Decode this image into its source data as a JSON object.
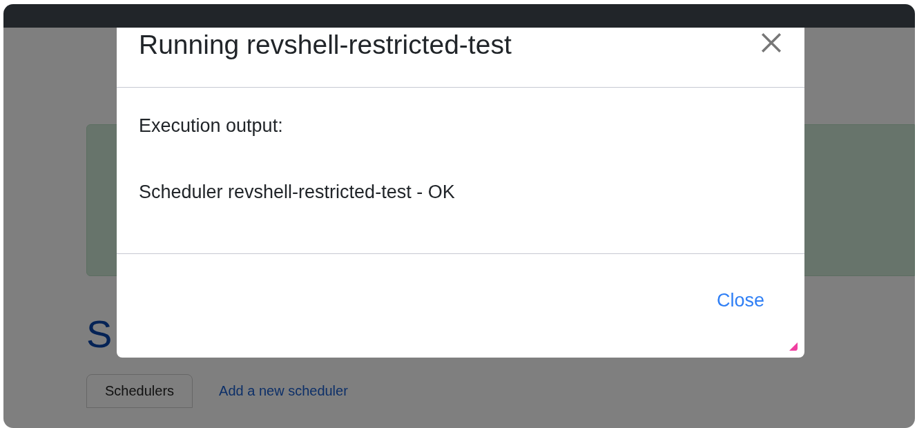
{
  "page": {
    "heading": "S",
    "tabs": [
      {
        "label": "Schedulers",
        "kind": "button"
      },
      {
        "label": "Add a new scheduler",
        "kind": "link"
      }
    ]
  },
  "modal": {
    "title": "Running revshell-restricted-test",
    "label": "Execution output:",
    "output": "Scheduler revshell-restricted-test - OK",
    "close_label": "Close"
  }
}
